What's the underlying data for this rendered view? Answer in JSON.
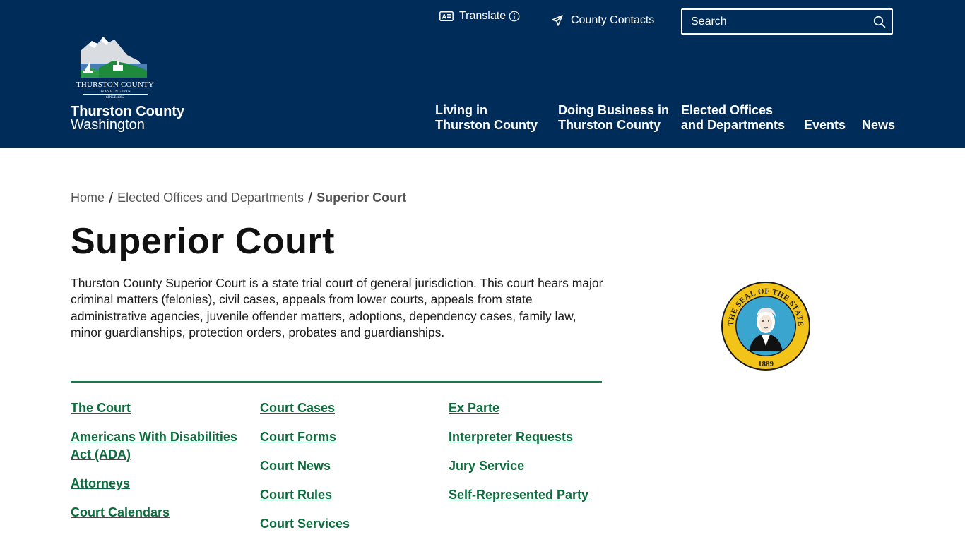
{
  "header": {
    "logo": {
      "caption": "THURSTON COUNTY",
      "state": "WASHINGTON",
      "since": "SINCE 1852"
    },
    "site_name": "Thurston County",
    "site_sub": "Washington",
    "utility": {
      "translate": "Translate",
      "county_contacts": "County Contacts",
      "search_placeholder": "Search"
    },
    "nav": {
      "living_1": "Living in",
      "living_2": "Thurston County",
      "business_1": "Doing Business in",
      "business_2": "Thurston County",
      "elected_1": "Elected Offices",
      "elected_2": "and Departments",
      "events": "Events",
      "news": "News"
    }
  },
  "breadcrumb": {
    "home": "Home",
    "elected": "Elected Offices and Departments",
    "current": "Superior Court"
  },
  "page": {
    "title": "Superior Court",
    "intro": "Thurston County Superior Court is a state trial court of general jurisdiction. This court hears major criminal matters (felonies), civil cases, appeals from lower courts, appeals from state administrative agencies, juvenile offender matters, adoptions, dependency cases, family law, minor guardianships, protection orders, probates and guardianships."
  },
  "seal": {
    "text": "THE SEAL OF THE STATE OF WASHINGTON",
    "year": "1889"
  },
  "links": {
    "col1": [
      "The Court",
      "Americans With Disabilities Act (ADA)",
      "Attorneys",
      "Court Calendars"
    ],
    "col2": [
      "Court Cases",
      "Court Forms",
      "Court News",
      "Court Rules",
      "Court Services"
    ],
    "col3": [
      "Ex Parte",
      "Interpreter Requests",
      "Jury Service",
      "Self-Represented Party"
    ]
  },
  "colors": {
    "header_bg": "#002c5a",
    "link_green": "#0d6b3d",
    "divider": "#1b7a4a",
    "seal_gold": "#f2c318",
    "seal_blue": "#3aa6cf"
  }
}
